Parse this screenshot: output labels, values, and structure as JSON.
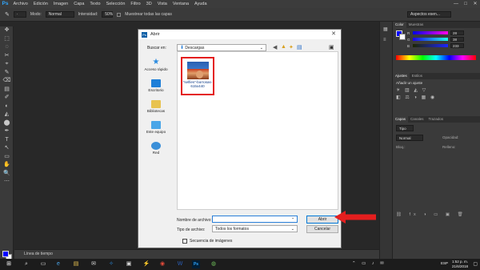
{
  "app": {
    "logo": "Ps"
  },
  "menubar": {
    "items": [
      "Archivo",
      "Edición",
      "Imagen",
      "Capa",
      "Texto",
      "Selección",
      "Filtro",
      "3D",
      "Vista",
      "Ventana",
      "Ayuda"
    ],
    "minimize": "—",
    "maximize": "□",
    "close": "✕"
  },
  "options": {
    "mode_label": "Modo:",
    "mode_value": "Normal",
    "intensity_label": "Intensidad:",
    "intensity_value": "50%",
    "sample_label": "Muestrear todas las capas",
    "workspace": "Aspectos esen..."
  },
  "tools": [
    "✥",
    "⬚",
    "◌",
    "✂",
    "⌖",
    "✎",
    "⌫",
    "▤",
    "✐",
    "◐",
    "◭",
    "⬤",
    "✒",
    "T",
    "↖",
    "▭",
    "✋",
    "🔍",
    "⋯"
  ],
  "timeline": {
    "label": "Línea de tiempo"
  },
  "panels": {
    "color_tabs": [
      "Color",
      "Muestras"
    ],
    "rgb": [
      {
        "label": "R",
        "value": "28"
      },
      {
        "label": "G",
        "value": "38"
      },
      {
        "label": "B",
        "value": "233"
      }
    ],
    "adjust_tabs": [
      "Ajustes",
      "Estilos"
    ],
    "adjust_hint": "Añadir un ajuste",
    "layers_tabs": [
      "Capas",
      "Canales",
      "Trazados"
    ],
    "layers_kind": "Tipo",
    "layers_blend": "Normal",
    "opacity_label": "Opacidad:",
    "lock_label": "Bloq.:",
    "fill_label": "Relleno:"
  },
  "dialog": {
    "title": "Abrir",
    "close": "✕",
    "lookin_label": "Buscar en:",
    "lookin_value": "Descargas",
    "places": [
      "Acceso rápido",
      "Escritorio",
      "Bibliotecas",
      "Este equipo",
      "Red"
    ],
    "file_name": "\"selfies\"-borrosas-615x440",
    "filename_label": "Nombre de archivo:",
    "filename_value": "",
    "filetype_label": "Tipo de archivo:",
    "filetype_value": "Todos los formatos",
    "open_button": "Abrir",
    "cancel_button": "Cancelar",
    "sequence_label": "Secuencia de imágenes"
  },
  "taskbar": {
    "time": "1:52 p. m.",
    "date": "21/6/2018",
    "lang": "ESP"
  },
  "colors": {
    "foreground": "#0000ff",
    "annotation": "#e41e1e",
    "ps_blue": "#31a8ff"
  }
}
